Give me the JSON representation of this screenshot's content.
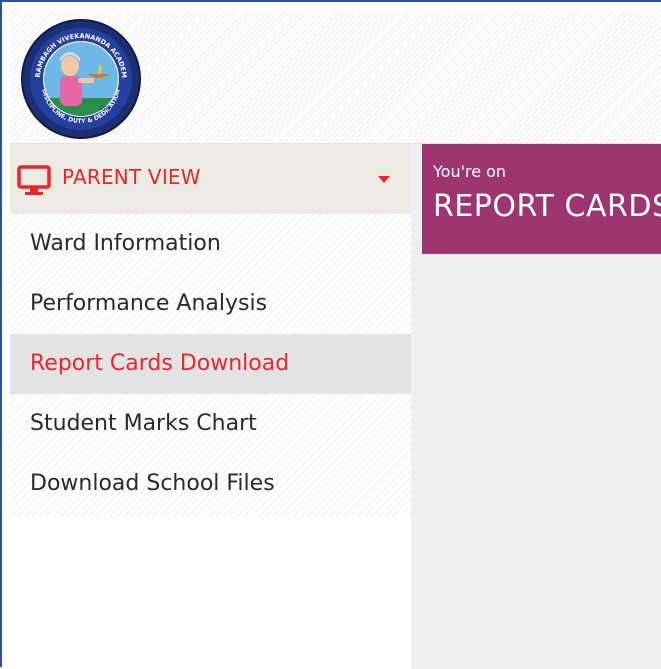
{
  "logo": {
    "text": "ARAMBAGH VIVEKANANDA ACADEMY · DISCIPLINE, DUTY & DEDICATION · ESTD. 2008",
    "icon": "school-crest-logo"
  },
  "sidebar": {
    "title": "PARENT VIEW",
    "title_icon": "monitor-icon",
    "toggle_icon": "caret-down-icon",
    "items": [
      {
        "label": "Ward Information",
        "active": false
      },
      {
        "label": "Performance Analysis",
        "active": false
      },
      {
        "label": "Report Cards Download",
        "active": true
      },
      {
        "label": "Student Marks Chart",
        "active": false
      },
      {
        "label": "Download School Files",
        "active": false
      }
    ]
  },
  "banner": {
    "subtitle": "You're on",
    "title": "REPORT CARDS DOWNLOAD"
  },
  "colors": {
    "accent_red": "#e8262b",
    "banner": "#9c3570",
    "frame_border": "#2e4f9e"
  }
}
